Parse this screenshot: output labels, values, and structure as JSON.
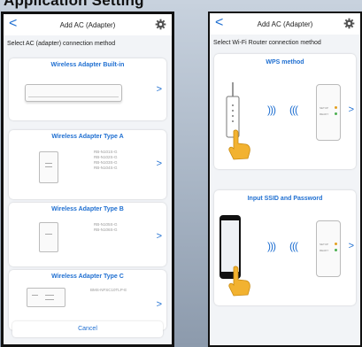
{
  "heading": "Application Setting",
  "left_screen": {
    "nav": {
      "back_glyph": "<",
      "title": "Add AC (Adapter)",
      "settings_icon": "gear-icon"
    },
    "subtitle": "Select AC (adapter) connection method",
    "options": [
      {
        "title": "Wireless Adapter Built-in",
        "models": []
      },
      {
        "title": "Wireless Adapter Type A",
        "models": [
          "RB-N101S-G",
          "RB-N102S-G",
          "RB-N103S-G",
          "RB-N104S-G"
        ]
      },
      {
        "title": "Wireless Adapter Type B",
        "models": [
          "RB-N105S-G",
          "RB-N106S-G"
        ]
      },
      {
        "title": "Wireless Adapter Type C",
        "models": [
          "BMS-NFSC10TLP-E"
        ]
      }
    ],
    "chevron_glyph": ">",
    "cancel_label": "Cancel"
  },
  "right_screen": {
    "nav": {
      "back_glyph": "<",
      "title": "Add AC (Adapter)",
      "settings_icon": "gear-icon"
    },
    "subtitle": "Select Wi-Fi Router connection method",
    "options": [
      {
        "title": "WPS method"
      },
      {
        "title": "Input SSID and Password"
      }
    ],
    "chevron_glyph": ">",
    "wave_left": ")))",
    "wave_right": "(((",
    "adapter_labels": [
      "SETUP",
      "READY"
    ]
  },
  "colors": {
    "accent": "#1f6fd1",
    "hand": "#f2b230"
  }
}
